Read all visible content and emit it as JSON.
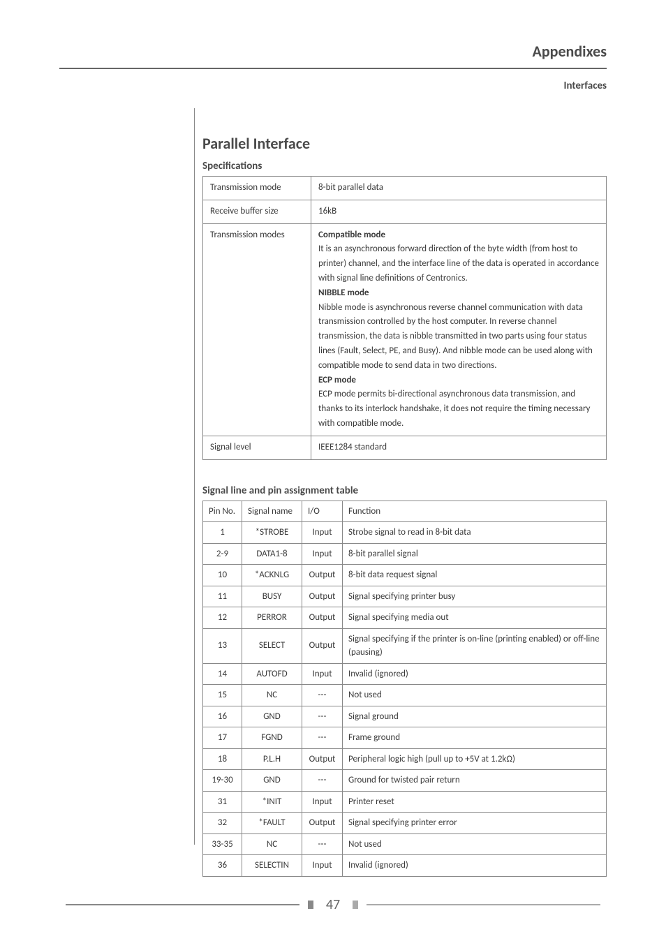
{
  "header": {
    "title": "Appendixes",
    "subtitle": "Interfaces"
  },
  "section": {
    "title": "Parallel Interface",
    "specs_title": "Specifications",
    "pins_title": "Signal line and pin assignment table"
  },
  "specs": [
    {
      "label": "Transmission mode",
      "value": "8-bit parallel data"
    },
    {
      "label": "Receive buffer size",
      "value": "16kB"
    },
    {
      "label": "Transmission modes",
      "modes": [
        {
          "title": "Compatible mode",
          "desc": "It is an asynchronous forward direction of the byte width (from host to printer) channel, and the interface line of the data is operated in accordance with signal line definitions of Centronics."
        },
        {
          "title": "NIBBLE mode",
          "desc": "Nibble mode is asynchronous reverse channel communication with data transmission controlled by the host computer. In reverse channel transmission, the data is nibble transmitted in two parts using four status lines (Fault, Select, PE, and Busy). And nibble mode can be used along with compatible mode to send data in two directions."
        },
        {
          "title": "ECP mode",
          "desc": "ECP mode permits bi-directional asynchronous data transmission, and thanks to its interlock handshake, it does not require the timing necessary with compatible mode."
        }
      ]
    },
    {
      "label": "Signal level",
      "value": "IEEE1284 standard"
    }
  ],
  "pin_header": {
    "c1": "Pin No.",
    "c2": "Signal name",
    "c3": "I/O",
    "c4": "Function"
  },
  "pins": [
    {
      "no": "1",
      "name": "*STROBE",
      "io": "Input",
      "fn": "Strobe signal to read in 8-bit data"
    },
    {
      "no": "2-9",
      "name": "DATA1-8",
      "io": "Input",
      "fn": "8-bit parallel signal"
    },
    {
      "no": "10",
      "name": "*ACKNLG",
      "io": "Output",
      "fn": "8-bit data request signal"
    },
    {
      "no": "11",
      "name": "BUSY",
      "io": "Output",
      "fn": "Signal specifying printer busy"
    },
    {
      "no": "12",
      "name": "PERROR",
      "io": "Output",
      "fn": "Signal specifying media out"
    },
    {
      "no": "13",
      "name": "SELECT",
      "io": "Output",
      "fn": "Signal specifying if the printer is on-line (printing enabled) or off-line (pausing)"
    },
    {
      "no": "14",
      "name": "AUTOFD",
      "io": "Input",
      "fn": "Invalid (ignored)"
    },
    {
      "no": "15",
      "name": "NC",
      "io": "---",
      "fn": "Not used"
    },
    {
      "no": "16",
      "name": "GND",
      "io": "---",
      "fn": "Signal ground"
    },
    {
      "no": "17",
      "name": "FGND",
      "io": "---",
      "fn": "Frame ground"
    },
    {
      "no": "18",
      "name": "P.L.H",
      "io": "Output",
      "fn": "Peripheral logic high (pull up to +5V at 1.2kΩ)"
    },
    {
      "no": "19-30",
      "name": "GND",
      "io": "---",
      "fn": "Ground for twisted pair return"
    },
    {
      "no": "31",
      "name": "*INIT",
      "io": "Input",
      "fn": "Printer reset"
    },
    {
      "no": "32",
      "name": "*FAULT",
      "io": "Output",
      "fn": "Signal specifying printer error"
    },
    {
      "no": "33-35",
      "name": "NC",
      "io": "---",
      "fn": "Not used"
    },
    {
      "no": "36",
      "name": "SELECTIN",
      "io": "Input",
      "fn": "Invalid (ignored)"
    }
  ],
  "footer": {
    "page": "47"
  }
}
